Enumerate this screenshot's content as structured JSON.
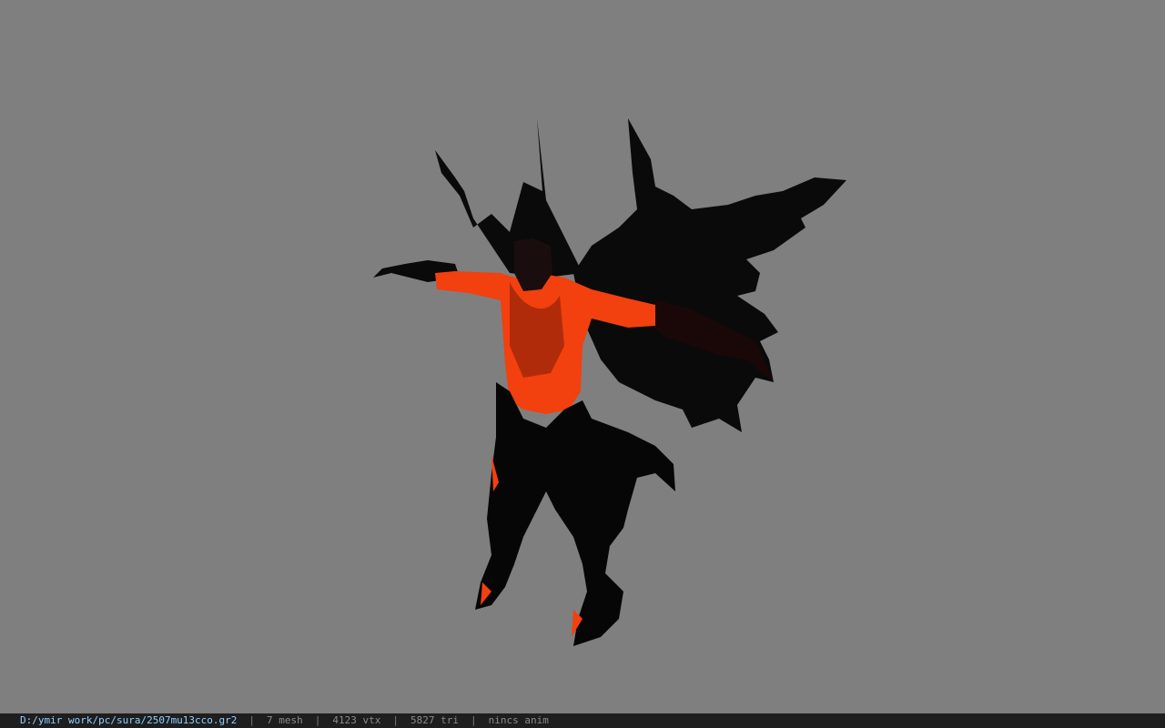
{
  "viewer": {
    "background_color": "#7f7f7f",
    "model_icon": "character-model"
  },
  "status": {
    "file_path": "D:/ymir work/pc/sura/2507mu13cco.gr2",
    "separator": "|",
    "mesh": "7 mesh",
    "vertices": "4123 vtx",
    "triangles": "5827 tri",
    "animation": "nincs anim"
  }
}
